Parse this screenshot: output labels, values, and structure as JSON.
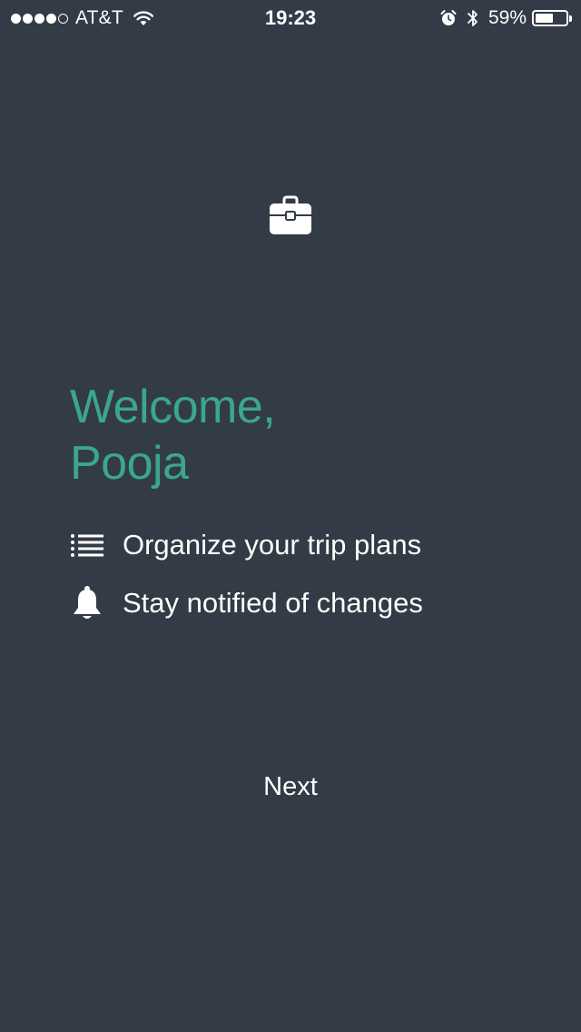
{
  "status_bar": {
    "signal_filled": 4,
    "signal_total": 5,
    "carrier": "AT&T",
    "time": "19:23",
    "battery_percent_label": "59%",
    "battery_level": 0.59,
    "icons": [
      "signal-dots",
      "wifi-icon",
      "alarm-icon",
      "bluetooth-icon",
      "battery-icon"
    ]
  },
  "welcome": {
    "icon": "briefcase-icon",
    "line1": "Welcome,",
    "line2": "Pooja"
  },
  "features": [
    {
      "icon": "list-icon",
      "text": "Organize your trip plans"
    },
    {
      "icon": "bell-icon",
      "text": "Stay notified of changes"
    }
  ],
  "actions": {
    "next_label": "Next"
  },
  "colors": {
    "background": "#333b46",
    "accent": "#3ba68e",
    "text": "#ffffff"
  }
}
